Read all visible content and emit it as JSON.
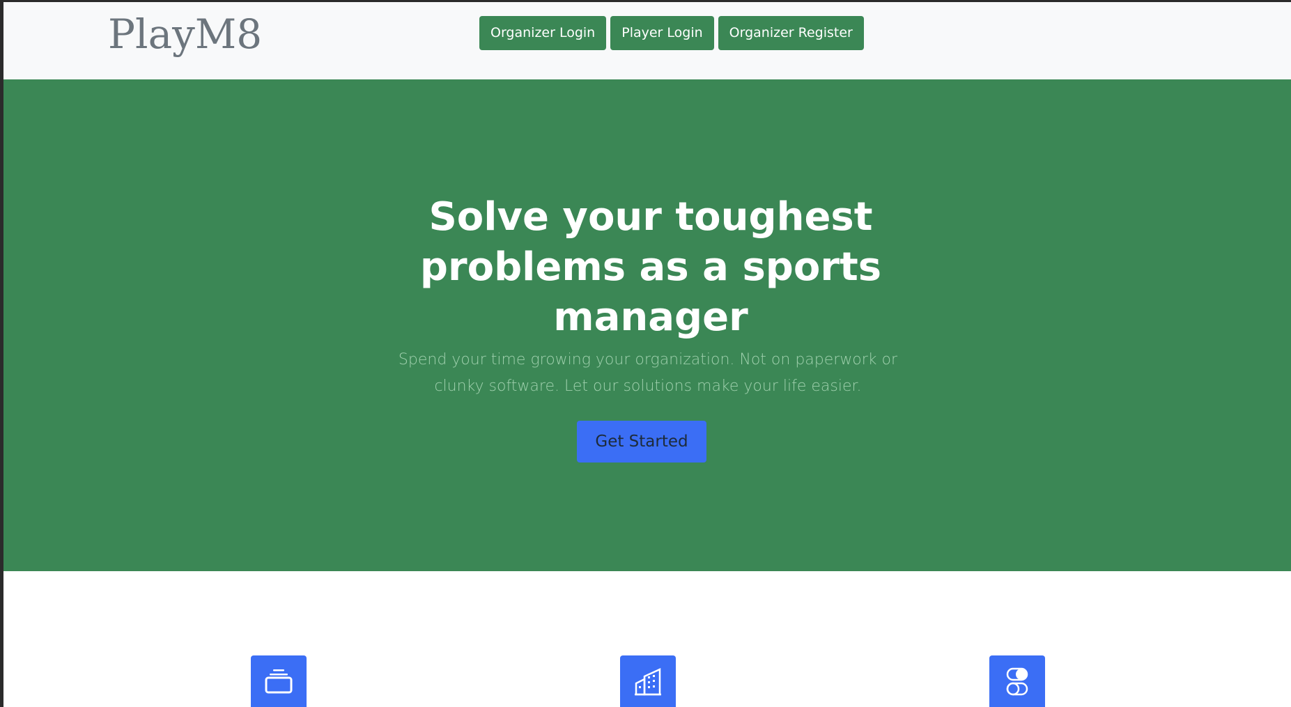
{
  "brand": {
    "name": "PlayM8"
  },
  "nav": {
    "buttons": [
      {
        "label": "Organizer Login"
      },
      {
        "label": "Player Login"
      },
      {
        "label": "Organizer Register"
      }
    ]
  },
  "hero": {
    "title": "Solve your toughest problems as a sports manager",
    "subtitle": "Spend your time growing your organization. Not on paperwork or clunky software. Let our solutions make your life easier.",
    "cta_label": "Get Started"
  },
  "features": {
    "icons": [
      "collection-icon",
      "building-icon",
      "toggles-icon"
    ]
  },
  "colors": {
    "green": "#3b8755",
    "blue": "#3b6ef5",
    "navbar_bg": "#f8f9fa"
  }
}
